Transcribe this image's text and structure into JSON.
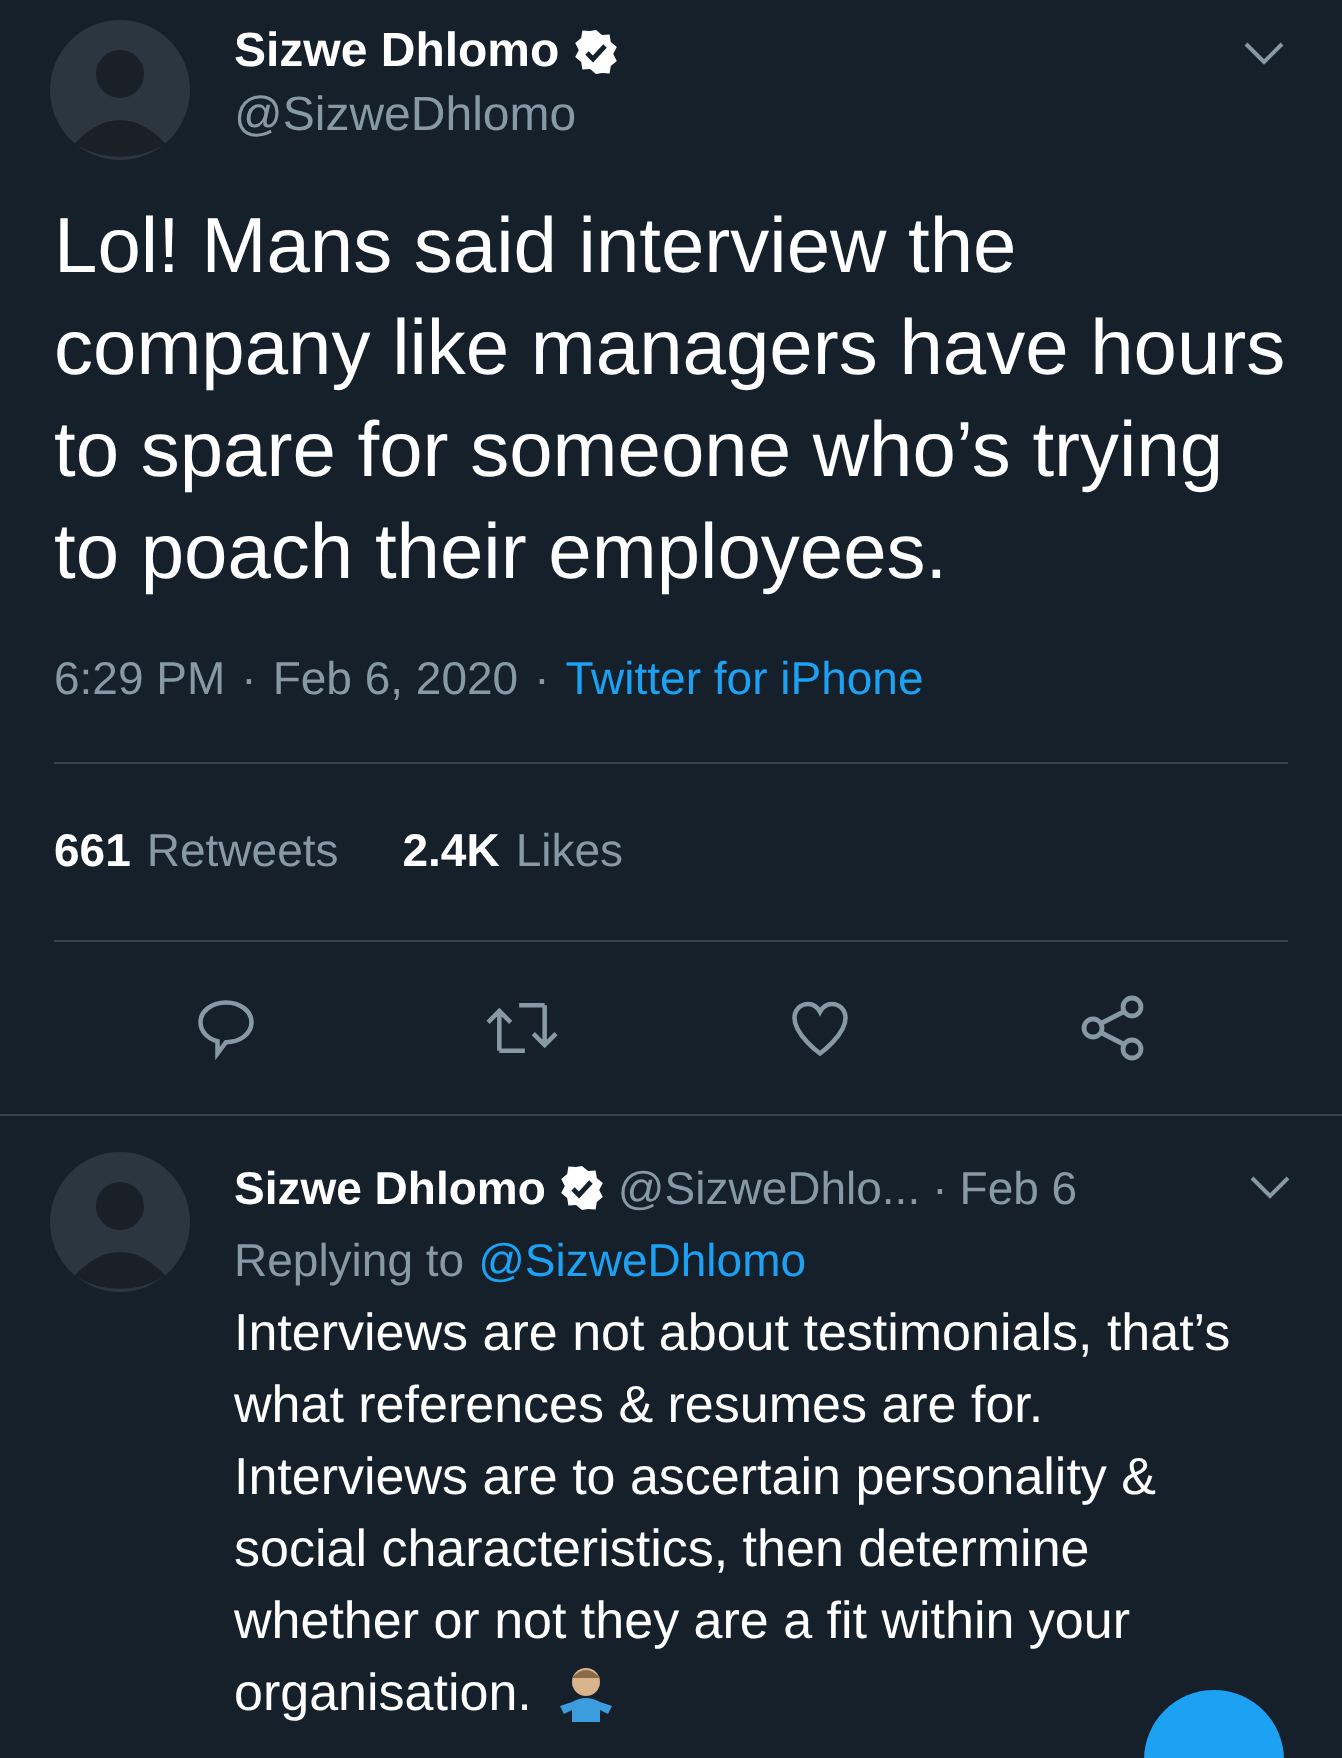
{
  "tweet": {
    "name": "Sizwe Dhlomo",
    "handle": "@SizweDhlomo",
    "verified": true,
    "text": "Lol! Mans said interview the company like managers have hours to spare for someone who’s trying to poach their employees.",
    "time": "6:29 PM",
    "date": "Feb 6, 2020",
    "separator": "·",
    "source": "Twitter for iPhone",
    "retweets_count": "661",
    "retweets_label": "Retweets",
    "likes_count": "2.4K",
    "likes_label": "Likes"
  },
  "reply": {
    "name": "Sizwe Dhlomo",
    "verified": true,
    "handle": "@SizweDhlo...",
    "separator": "·",
    "date": "Feb 6",
    "replying_label": "Replying to",
    "replying_handle": "@SizweDhlomo",
    "text": "Interviews are not about testimonials, that’s what references & resumes are for. Interviews are to ascertain personality & social characteristics, then determine whether or not they are a fit within your",
    "text_end": "organisation."
  }
}
